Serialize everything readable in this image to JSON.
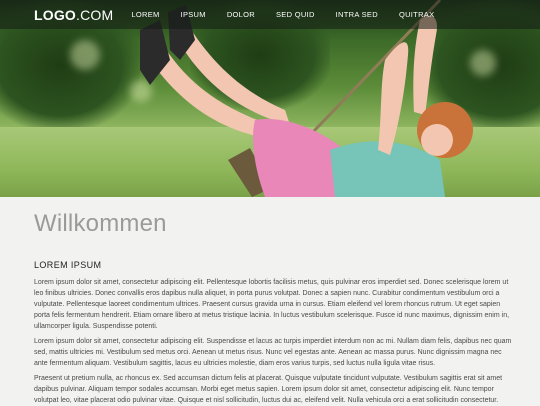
{
  "nav": {
    "logo_bold": "LOGO",
    "logo_light": ".COM",
    "items": [
      "LOREM",
      "IPSUM",
      "DOLOR",
      "SED QUID",
      "INTRA SED",
      "QUITRAX"
    ]
  },
  "hero": {
    "image_alt": "Child on a rope swing in a green park"
  },
  "main": {
    "title": "Willkommen",
    "section_heading": "LOREM IPSUM",
    "paragraphs": [
      "Lorem ipsum dolor sit amet, consectetur adipiscing elit. Pellentesque lobortis facilisis metus, quis pulvinar eros imperdiet sed. Donec scelerisque lorem ut leo finibus ultricies. Donec convallis eros dapibus nulla aliquet, in porta purus volutpat. Donec a sapien nunc. Curabitur condimentum vestibulum orci a vulputate. Pellentesque laoreet condimentum ultrices. Praesent cursus gravida urna in cursus. Etiam eleifend vel lorem rhoncus rutrum. Ut eget sapien porta felis fermentum hendrerit. Etiam ornare libero at metus tristique lacinia. In luctus vestibulum scelerisque. Fusce id nunc maximus, dignissim enim in, ullamcorper ligula. Suspendisse potenti.",
      "Lorem ipsum dolor sit amet, consectetur adipiscing elit. Suspendisse et lacus ac turpis imperdiet interdum non ac mi. Nullam diam felis, dapibus nec quam sed, mattis ultricies mi. Vestibulum sed metus orci. Aenean ut metus risus. Nunc vel egestas ante. Aenean ac massa purus. Nunc dignissim magna nec ante fermentum aliquam. Vestibulum sagittis, lacus eu ultricies molestie, diam eros varius turpis, sed luctus nulla ligula vitae risus.",
      "Praesent ut pretium nulla, ac rhoncus ex. Sed accumsan dictum felis at placerat. Quisque vulputate tincidunt vulputate. Vestibulum sagittis erat sit amet dapibus pulvinar. Aliquam tempor sodales accumsan. Morbi eget metus sapien. Lorem ipsum dolor sit amet, consectetur adipiscing elit. Nunc tempor volutpat leo, vitae placerat odio pulvinar vitae. Quisque et nisl sollicitudin, luctus dui ac, eleifend velit. Nulla vehicula orci a erat sollicitudin consectetur."
    ]
  }
}
